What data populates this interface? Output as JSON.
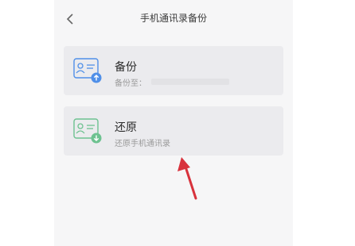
{
  "header": {
    "title": "手机通讯录备份"
  },
  "backup_card": {
    "title": "备份",
    "subtitle": "备份至："
  },
  "restore_card": {
    "title": "还原",
    "subtitle": "还原手机通讯录"
  },
  "colors": {
    "backup_icon": "#4f8fe8",
    "restore_icon": "#6dc290",
    "annotation_arrow": "#d8323c"
  },
  "icons": {
    "back": "chevron-left-icon",
    "backup": "contact-card-upload-icon",
    "restore": "contact-card-download-icon"
  }
}
